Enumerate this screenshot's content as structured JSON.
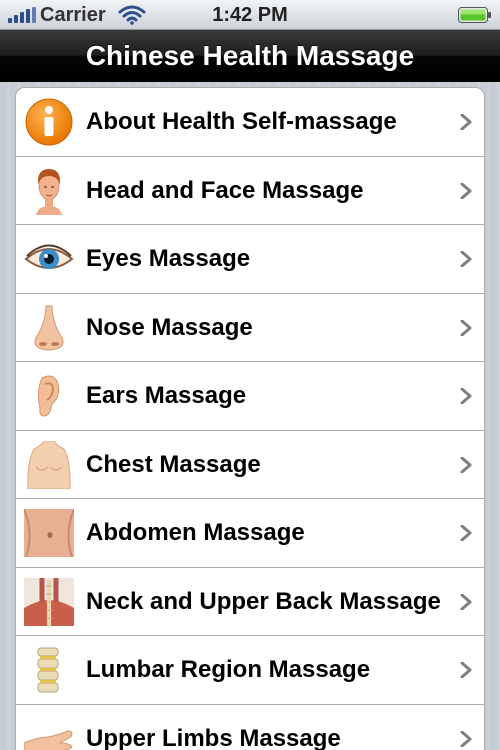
{
  "status_bar": {
    "carrier": "Carrier",
    "time": "1:42 PM"
  },
  "nav": {
    "title": "Chinese Health Massage"
  },
  "menu": {
    "items": [
      {
        "label": "About Health Self-massage",
        "icon": "info-icon"
      },
      {
        "label": "Head and Face Massage",
        "icon": "head-icon"
      },
      {
        "label": "Eyes Massage",
        "icon": "eye-icon"
      },
      {
        "label": "Nose Massage",
        "icon": "nose-icon"
      },
      {
        "label": "Ears Massage",
        "icon": "ear-icon"
      },
      {
        "label": "Chest Massage",
        "icon": "chest-icon"
      },
      {
        "label": "Abdomen Massage",
        "icon": "abdomen-icon"
      },
      {
        "label": "Neck and Upper Back Massage",
        "icon": "neck-back-icon"
      },
      {
        "label": "Lumbar Region Massage",
        "icon": "lumbar-icon"
      },
      {
        "label": "Upper Limbs Massage",
        "icon": "hand-icon"
      }
    ]
  },
  "colors": {
    "nav_background": "#000000",
    "info_orange": "#f08a14",
    "chevron": "#7f7f7f",
    "signal_blue": "#2c4f8c",
    "battery_green": "#57c528"
  }
}
